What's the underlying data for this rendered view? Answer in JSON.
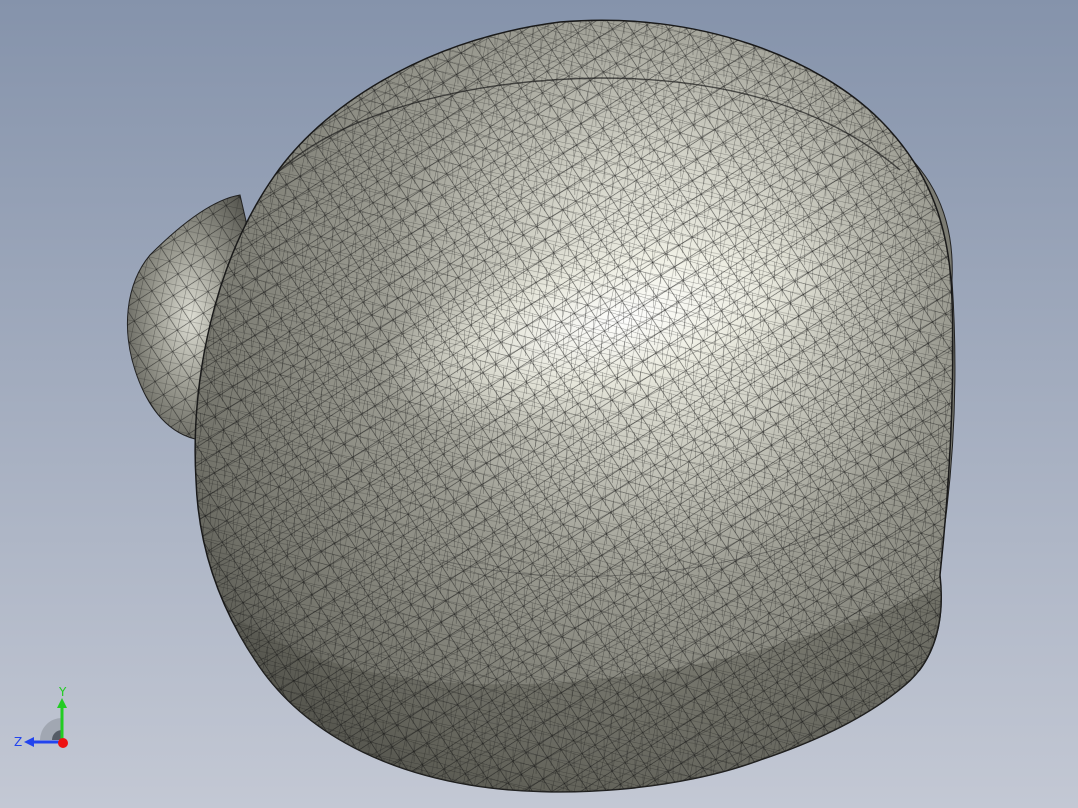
{
  "viewport": {
    "background_top": "#8593ab",
    "background_bottom": "#c3c8d4",
    "model": {
      "name": "mesh-model",
      "surface_color": "#9c9c92",
      "highlight_color": "#f4f4ea",
      "shadow_color": "#55554e",
      "edge_color": "#111111"
    }
  },
  "triad": {
    "y_label": "Y",
    "z_label": "Z",
    "y_color": "#22cc22",
    "z_color": "#2244ee",
    "x_color": "#ee1111"
  }
}
